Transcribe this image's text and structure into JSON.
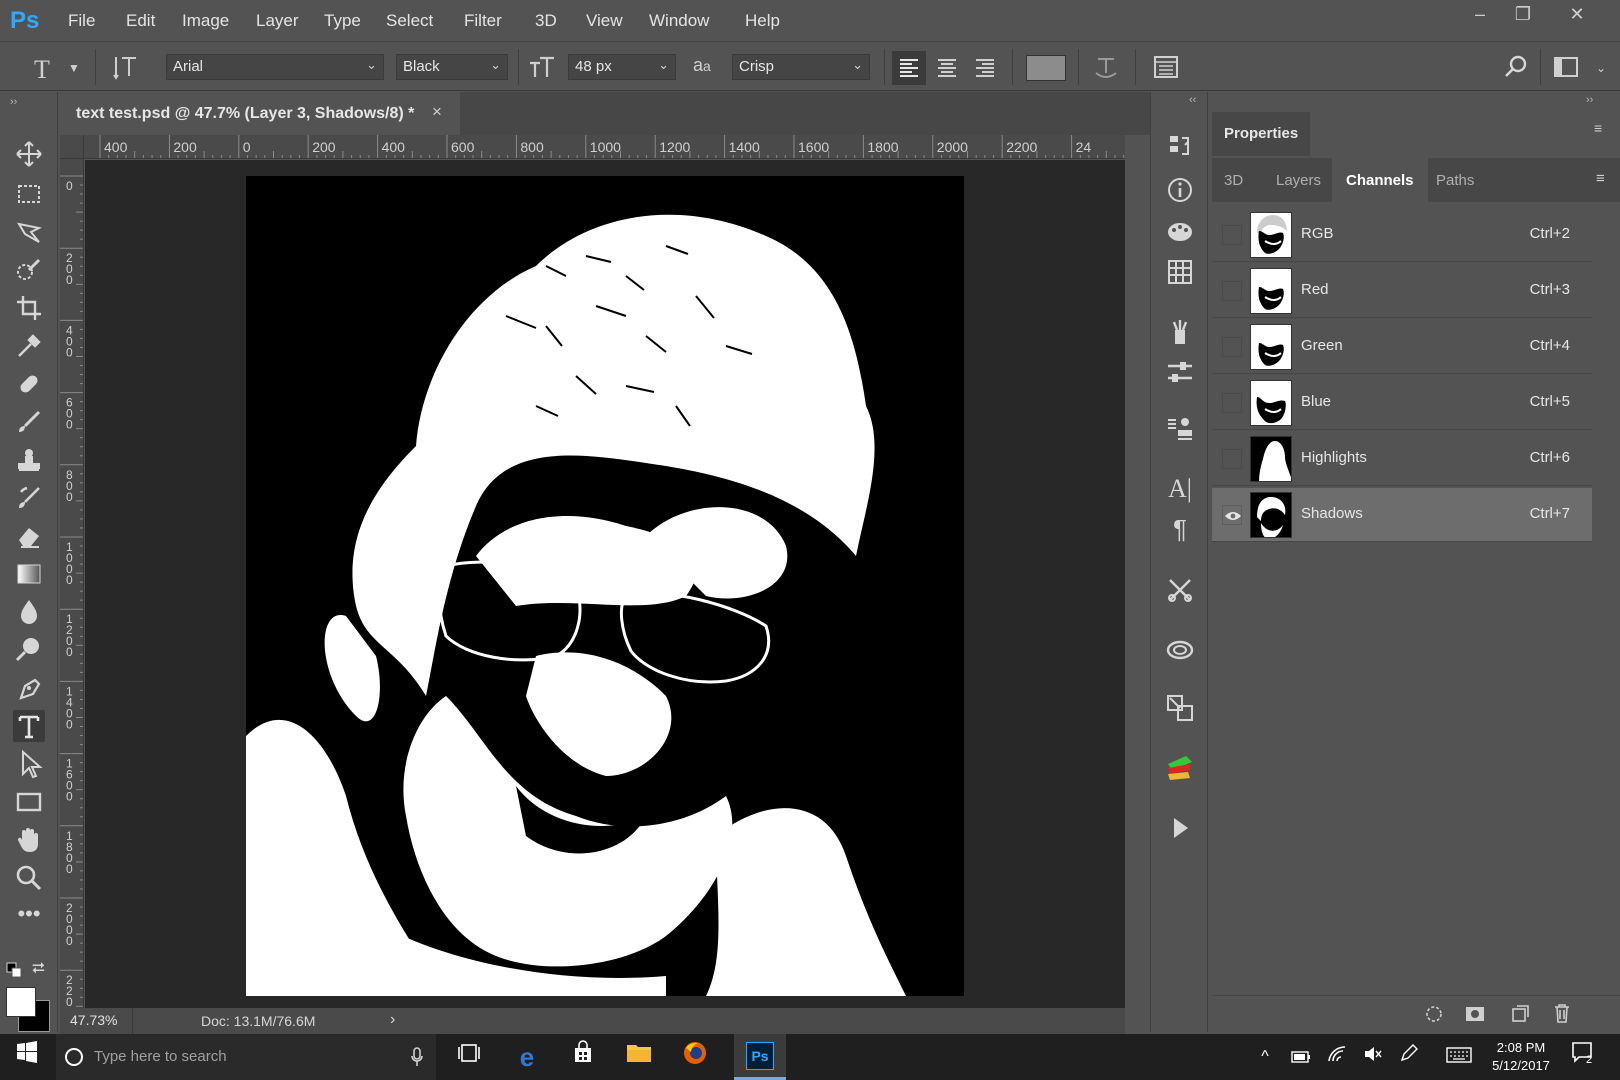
{
  "app": {
    "name": "Ps",
    "accent": "#31a8ff"
  },
  "menu": [
    "File",
    "Edit",
    "Image",
    "Layer",
    "Type",
    "Select",
    "Filter",
    "3D",
    "View",
    "Window",
    "Help"
  ],
  "options": {
    "font_family": "Arial",
    "font_style": "Black",
    "font_size": "48 px",
    "antialias_label": "a",
    "antialias_sub": "a",
    "antialias": "Crisp"
  },
  "document": {
    "tab_title": "text test.psd @ 47.7% (Layer 3, Shadows/8) *",
    "close_glyph": "×",
    "ruler_h": [
      "400",
      "200",
      "0",
      "200",
      "400",
      "600",
      "800",
      "1000",
      "1200",
      "1400",
      "1600",
      "1800",
      "2000",
      "2200",
      "24"
    ],
    "ruler_v": [
      "0",
      "200",
      "400",
      "600",
      "800",
      "1000",
      "1200",
      "1400",
      "1600",
      "1800",
      "2000",
      "2200"
    ]
  },
  "status": {
    "zoom": "47.73%",
    "doc": "Doc: 13.1M/76.6M",
    "arrow": "›"
  },
  "panel": {
    "title": "Properties",
    "tabs": [
      "3D",
      "Layers",
      "Channels",
      "Paths"
    ],
    "active_tab": "Channels",
    "channels": [
      {
        "name": "RGB",
        "shortcut": "Ctrl+2",
        "visible": false
      },
      {
        "name": "Red",
        "shortcut": "Ctrl+3",
        "visible": false
      },
      {
        "name": "Green",
        "shortcut": "Ctrl+4",
        "visible": false
      },
      {
        "name": "Blue",
        "shortcut": "Ctrl+5",
        "visible": false
      },
      {
        "name": "Highlights",
        "shortcut": "Ctrl+6",
        "visible": false
      },
      {
        "name": "Shadows",
        "shortcut": "Ctrl+7",
        "visible": true
      }
    ]
  },
  "taskbar": {
    "search_placeholder": "Type here to search",
    "time": "2:08 PM",
    "date": "5/12/2017",
    "notifications": "2"
  },
  "colors": {
    "foreground": "#ffffff",
    "background": "#000000"
  }
}
